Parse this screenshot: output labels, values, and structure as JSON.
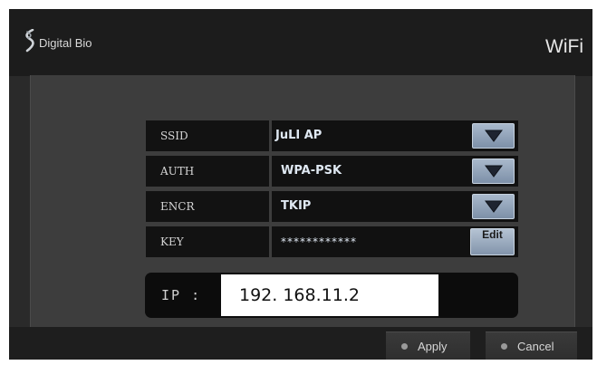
{
  "header": {
    "brand": "Digital Bio",
    "title": "WiFi"
  },
  "form": {
    "rows": [
      {
        "label": "SSID",
        "value": "JuLI AP",
        "control": "dropdown-arrow-icon"
      },
      {
        "label": "AUTH",
        "value": "WPA-PSK",
        "control": "dropdown-arrow-icon"
      },
      {
        "label": "ENCR",
        "value": "TKIP",
        "control": "dropdown-arrow-icon"
      },
      {
        "label": "KEY",
        "value": "************",
        "control_label": "Edit"
      }
    ],
    "ip": {
      "label": "IP :",
      "value": "192. 168.11.2"
    }
  },
  "footer": {
    "apply_label": "Apply",
    "cancel_label": "Cancel"
  },
  "colors": {
    "background": "#2a2a2a",
    "panel": "#3d3d3d",
    "field": "#111111",
    "button_accent": "#8fa2b8"
  }
}
